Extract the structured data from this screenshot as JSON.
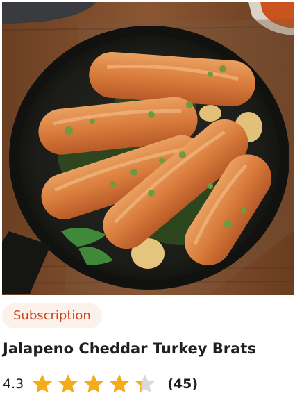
{
  "card": {
    "badge_label": "Subscription",
    "title": "Jalapeno Cheddar Turkey Brats",
    "rating_value": "4.3",
    "rating_count": "(45)",
    "rating_stars": 4.3,
    "star_color": "#f5ac1b",
    "star_empty_color": "#d9d9d9",
    "badge_text_color": "#c8481d",
    "badge_bg_color": "#fdf1eb"
  }
}
